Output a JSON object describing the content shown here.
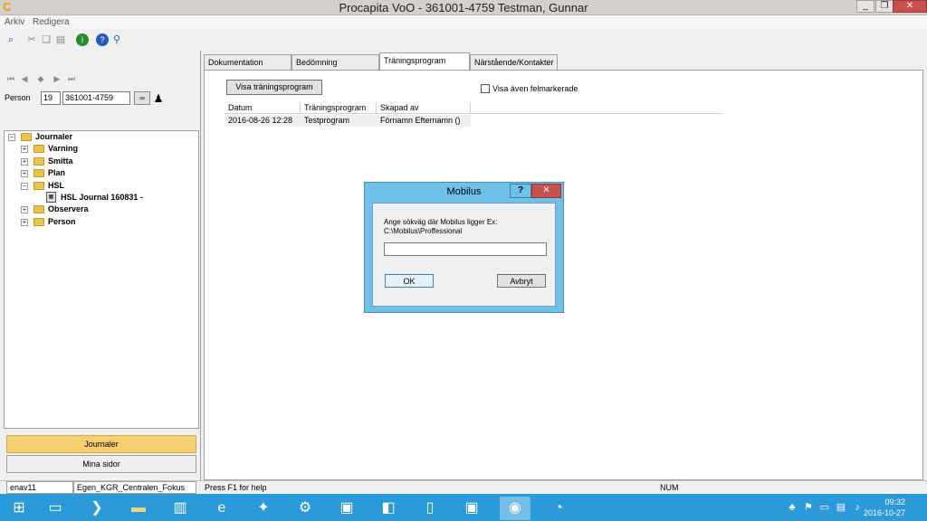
{
  "window": {
    "title": "Procapita VoO - 361001-4759 Testman, Gunnar",
    "minimize_glyph": "_",
    "restore_glyph": "❐",
    "close_glyph": "✕"
  },
  "menu": {
    "arkiv": "Arkiv",
    "redigera": "Redigera"
  },
  "person": {
    "label": "Person",
    "prefix": "19",
    "id": "361001-4759"
  },
  "tree": {
    "journaler": "Journaler",
    "varning": "Varning",
    "smitta": "Smitta",
    "plan": "Plan",
    "hsl": "HSL",
    "hsl_journal": "HSL Journal 160831 -",
    "observera": "Observera",
    "person": "Person"
  },
  "nav": {
    "journaler": "Journaler",
    "mina_sidor": "Mina sidor"
  },
  "tabs": [
    {
      "label": "Dokumentation"
    },
    {
      "label": "Bedömning"
    },
    {
      "label": "Träningsprogram"
    },
    {
      "label": "Närstående/Kontakter"
    }
  ],
  "content": {
    "show_button": "Visa träningsprogram",
    "checkbox_label": "Visa även felmarkerade",
    "columns": [
      "Datum",
      "Träningsprogram",
      "Skapad av"
    ],
    "rows": [
      [
        "2016-08-26 12:28",
        "Testprogram",
        "Förnamn Efternamn ()"
      ]
    ]
  },
  "status": {
    "user": "enav11",
    "unit": "Egen_KGR_Centralen_Fokus",
    "help": "Press F1 for help",
    "num": "NUM"
  },
  "dialog": {
    "title": "Mobilus",
    "help_glyph": "?",
    "close_glyph": "✕",
    "prompt_line1": "Ange sökväg där Mobilus ligger Ex:",
    "prompt_line2": "C:\\Mobilus\\Proffessional",
    "input_value": "",
    "ok_label": "OK",
    "cancel_label": "Avbryt"
  },
  "clock": {
    "time": "09:32",
    "date": "2016-10-27"
  },
  "colors": {
    "taskbar": "#2b9ad8",
    "dialog_frame": "#6ec2e8",
    "active_nav": "#f6cf72",
    "close_button": "#c75050"
  }
}
